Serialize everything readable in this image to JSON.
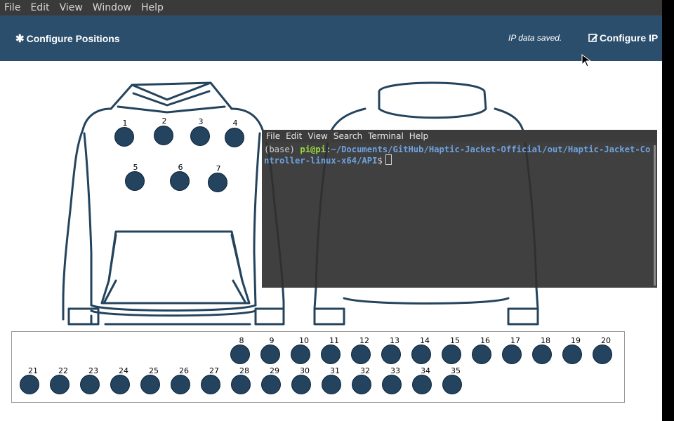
{
  "menubar": [
    "File",
    "Edit",
    "View",
    "Window",
    "Help"
  ],
  "header": {
    "configure_positions_label": "Configure Positions",
    "status": "IP data saved.",
    "configure_ip_label": "Configure IP"
  },
  "jacket_actuators": [
    "1",
    "2",
    "3",
    "4",
    "5",
    "6",
    "7"
  ],
  "unplaced_actuators": [
    "8",
    "9",
    "10",
    "11",
    "12",
    "13",
    "14",
    "15",
    "16",
    "17",
    "18",
    "19",
    "20",
    "21",
    "22",
    "23",
    "24",
    "25",
    "26",
    "27",
    "28",
    "29",
    "30",
    "31",
    "32",
    "33",
    "34",
    "35"
  ],
  "terminal": {
    "menu": [
      "File",
      "Edit",
      "View",
      "Search",
      "Terminal",
      "Help"
    ],
    "prefix": "(base) ",
    "user": "pi@pi",
    "colon": ":",
    "path": "~/Documents/GitHub/Haptic-Jacket-Official/out/Haptic-Jacket-Controller-linux-x64/API",
    "dollar": "$"
  },
  "colors": {
    "header_bg": "#2b4e6c",
    "actuator_fill": "#23435f",
    "terminal_bg": "#303030",
    "prompt_user": "#9ad845",
    "prompt_path": "#6ea2e0"
  }
}
